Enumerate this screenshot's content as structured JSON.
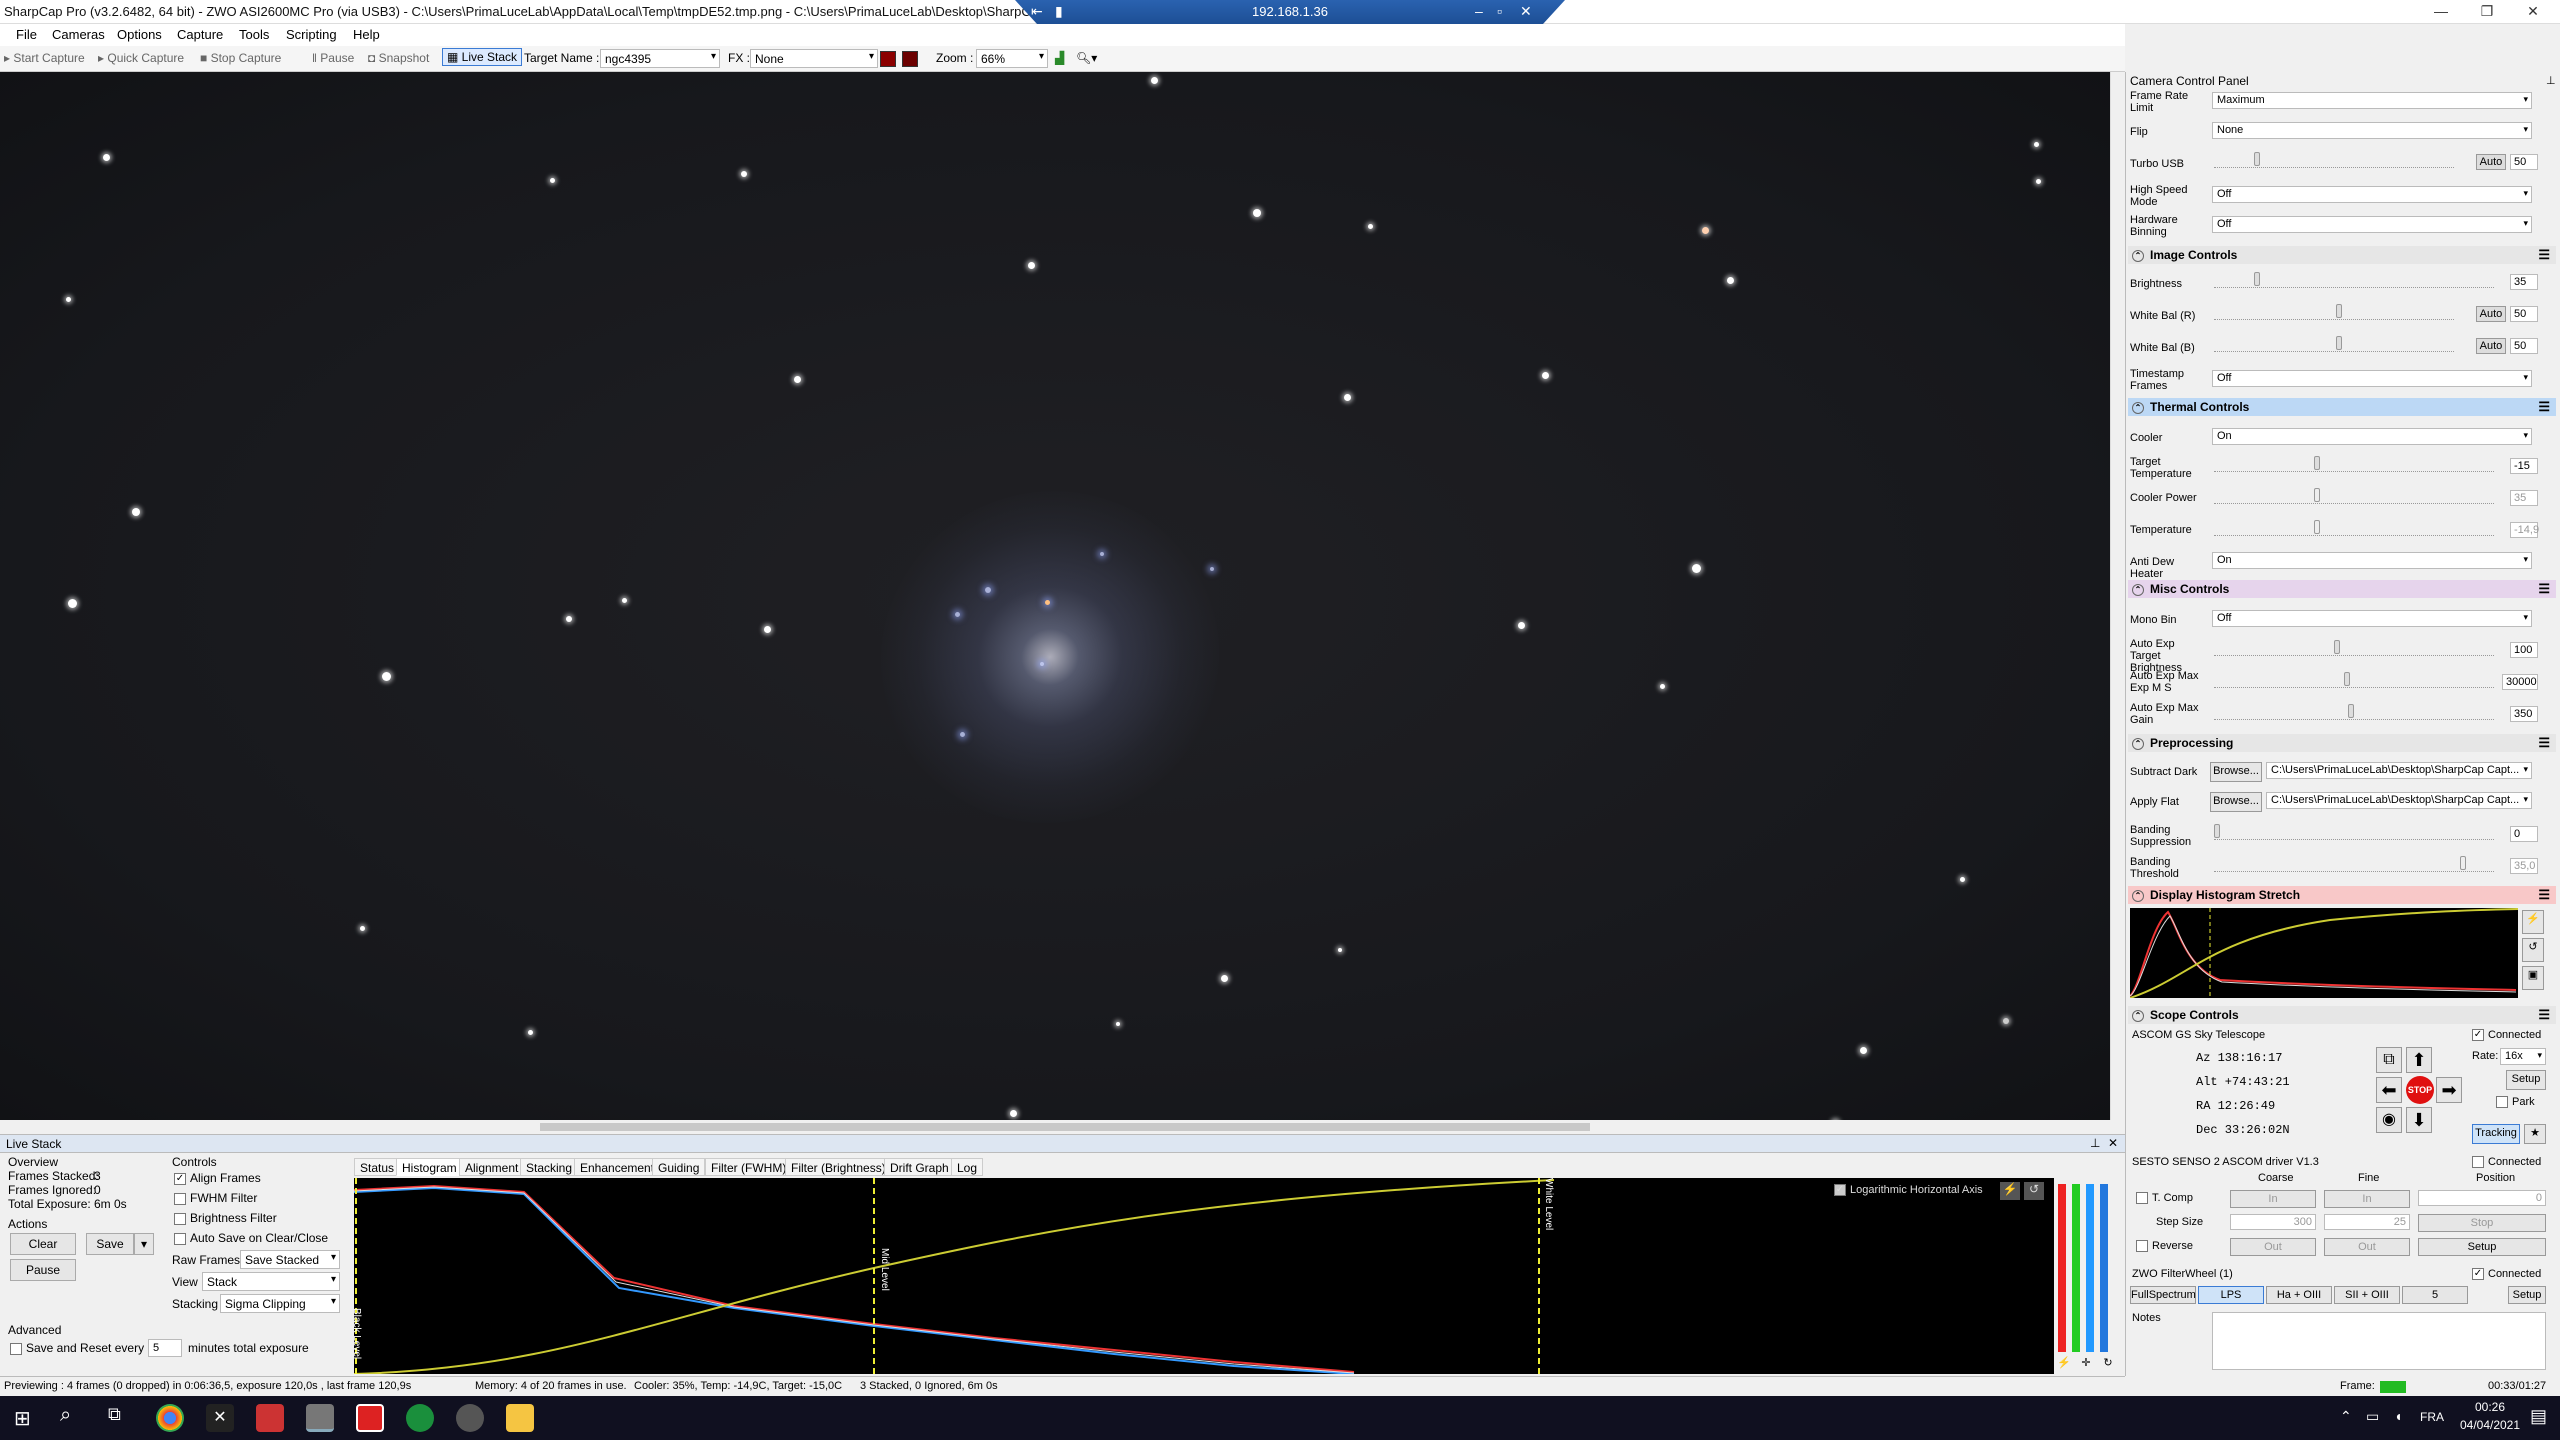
{
  "title": "SharpCap Pro (v3.2.6482, 64 bit) - ZWO ASI2600MC Pro (via USB3) - C:\\Users\\PrimaLuceLab\\AppData\\Local\\Temp\\tmpDE52.tmp.png - C:\\Users\\PrimaLuceLab\\Desktop\\SharpCap Capture",
  "remote_ip": "192.168.1.36",
  "menu": [
    "File",
    "Cameras",
    "Options",
    "Capture",
    "Tools",
    "Scripting",
    "Help"
  ],
  "toolbar": {
    "start_capture": "Start Capture",
    "quick_capture": "Quick Capture",
    "stop_capture": "Stop Capture",
    "pause": "Pause",
    "snapshot": "Snapshot",
    "live_stack": "Live Stack",
    "target_label": "Target Name :",
    "target_value": "ngc4395",
    "fx_label": "FX :",
    "fx_value": "None",
    "zoom_label": "Zoom :",
    "zoom_value": "66%"
  },
  "live_stack": {
    "title": "Live Stack",
    "overview_label": "Overview",
    "frames_stacked_label": "Frames Stacked:",
    "frames_stacked": "3",
    "frames_ignored_label": "Frames Ignored:",
    "frames_ignored": "0",
    "total_exposure_label": "Total Exposure:",
    "total_exposure": "6m 0s",
    "actions_label": "Actions",
    "clear": "Clear",
    "save": "Save",
    "pause": "Pause",
    "advanced_label": "Advanced",
    "save_reset_label": "Save and Reset every",
    "save_reset_value": "5",
    "minutes_label": "minutes total exposure",
    "controls_label": "Controls",
    "align_frames": "Align Frames",
    "fwhm_filter": "FWHM Filter",
    "brightness_filter": "Brightness Filter",
    "auto_save": "Auto Save on Clear/Close",
    "raw_frames_label": "Raw Frames",
    "raw_frames_value": "Save Stacked",
    "view_label": "View",
    "view_value": "Stack",
    "stacking_label": "Stacking",
    "stacking_value": "Sigma Clipping",
    "tabs": [
      "Status",
      "Histogram",
      "Alignment",
      "Stacking",
      "Enhancement",
      "Guiding",
      "Filter (FWHM)",
      "Filter (Brightness)",
      "Drift Graph",
      "Log"
    ],
    "log_axis": "Logarithmic Horizontal Axis",
    "black_level": "Black Level",
    "mid_level": "Mid Level",
    "white_level": "White Level"
  },
  "status_bar": {
    "preview": "Previewing : 4 frames (0 dropped) in 0:06:36,5, exposure 120,0s , last frame 120,9s",
    "memory": "Memory: 4 of 20 frames in use.",
    "cooler": "Cooler: 35%, Temp: -14,9C, Target: -15,0C",
    "stacked": "3 Stacked, 0 Ignored, 6m 0s",
    "frame_label": "Frame:",
    "frame_time": "00:33/01:27"
  },
  "panel": {
    "title": "Camera Control Panel",
    "frame_rate_label": "Frame Rate Limit",
    "frame_rate": "Maximum",
    "flip_label": "Flip",
    "flip": "None",
    "turbo_label": "Turbo USB",
    "turbo": "50",
    "high_speed_label": "High Speed Mode",
    "high_speed": "Off",
    "hw_binning_label": "Hardware Binning",
    "hw_binning": "Off",
    "image_controls": "Image Controls",
    "brightness_label": "Brightness",
    "brightness": "35",
    "wb_r_label": "White Bal (R)",
    "wb_r": "50",
    "wb_b_label": "White Bal (B)",
    "wb_b": "50",
    "timestamp_label": "Timestamp Frames",
    "timestamp": "Off",
    "auto": "Auto",
    "thermal_controls": "Thermal Controls",
    "cooler_label": "Cooler",
    "cooler": "On",
    "target_temp_label": "Target Temperature",
    "target_temp": "-15",
    "cooler_power_label": "Cooler Power",
    "cooler_power": "35",
    "temperature_label": "Temperature",
    "temperature": "-14,9",
    "dew_label": "Anti Dew Heater",
    "dew": "On",
    "misc_controls": "Misc Controls",
    "mono_bin_label": "Mono Bin",
    "mono_bin": "Off",
    "ae_target_label": "Auto Exp Target Brightness",
    "ae_target": "100",
    "ae_max_exp_label": "Auto Exp Max Exp M S",
    "ae_max_exp": "30000",
    "ae_max_gain_label": "Auto Exp Max Gain",
    "ae_max_gain": "350",
    "preprocessing": "Preprocessing",
    "subtract_dark_label": "Subtract Dark",
    "subtract_dark": "C:\\Users\\PrimaLuceLab\\Desktop\\SharpCap Capt...",
    "apply_flat_label": "Apply Flat",
    "apply_flat": "C:\\Users\\PrimaLuceLab\\Desktop\\SharpCap Capt...",
    "browse": "Browse...",
    "banding_supp_label": "Banding Suppression",
    "banding_supp": "0",
    "banding_thr_label": "Banding Threshold",
    "banding_thr": "35,0",
    "histo_stretch": "Display Histogram Stretch",
    "scope_controls": "Scope Controls",
    "scope_name": "ASCOM GS Sky Telescope",
    "connected": "Connected",
    "az": "Az  138:16:17",
    "alt": "Alt +74:43:21",
    "ra": "RA  12:26:49",
    "dec": "Dec 33:26:02N",
    "rate_label": "Rate:",
    "rate": "16x",
    "setup": "Setup",
    "park": "Park",
    "tracking": "Tracking",
    "stop": "STOP",
    "focuser_name": "SESTO SENSO 2 ASCOM driver V1.3",
    "coarse": "Coarse",
    "fine": "Fine",
    "position": "Position",
    "tcomp": "T. Comp",
    "in": "In",
    "out": "Out",
    "position_value": "0",
    "step_size_label": "Step Size",
    "step_coarse": "300",
    "step_fine": "25",
    "reverse": "Reverse",
    "stop_btn": "Stop",
    "filterwheel": "ZWO FilterWheel (1)",
    "filters": [
      "FullSpectrum",
      "LPS",
      "Ha + OIII",
      "SII + OIII",
      "5"
    ],
    "notes": "Notes"
  },
  "taskbar": {
    "lang": "FRA",
    "time": "00:26",
    "date": "04/04/2021"
  },
  "colors": {
    "accent": "#3b7bd4",
    "thermal": "#bcd8f5",
    "misc": "#e6d4ec",
    "histo": "#f8c8c8",
    "stop": "#e01010"
  }
}
